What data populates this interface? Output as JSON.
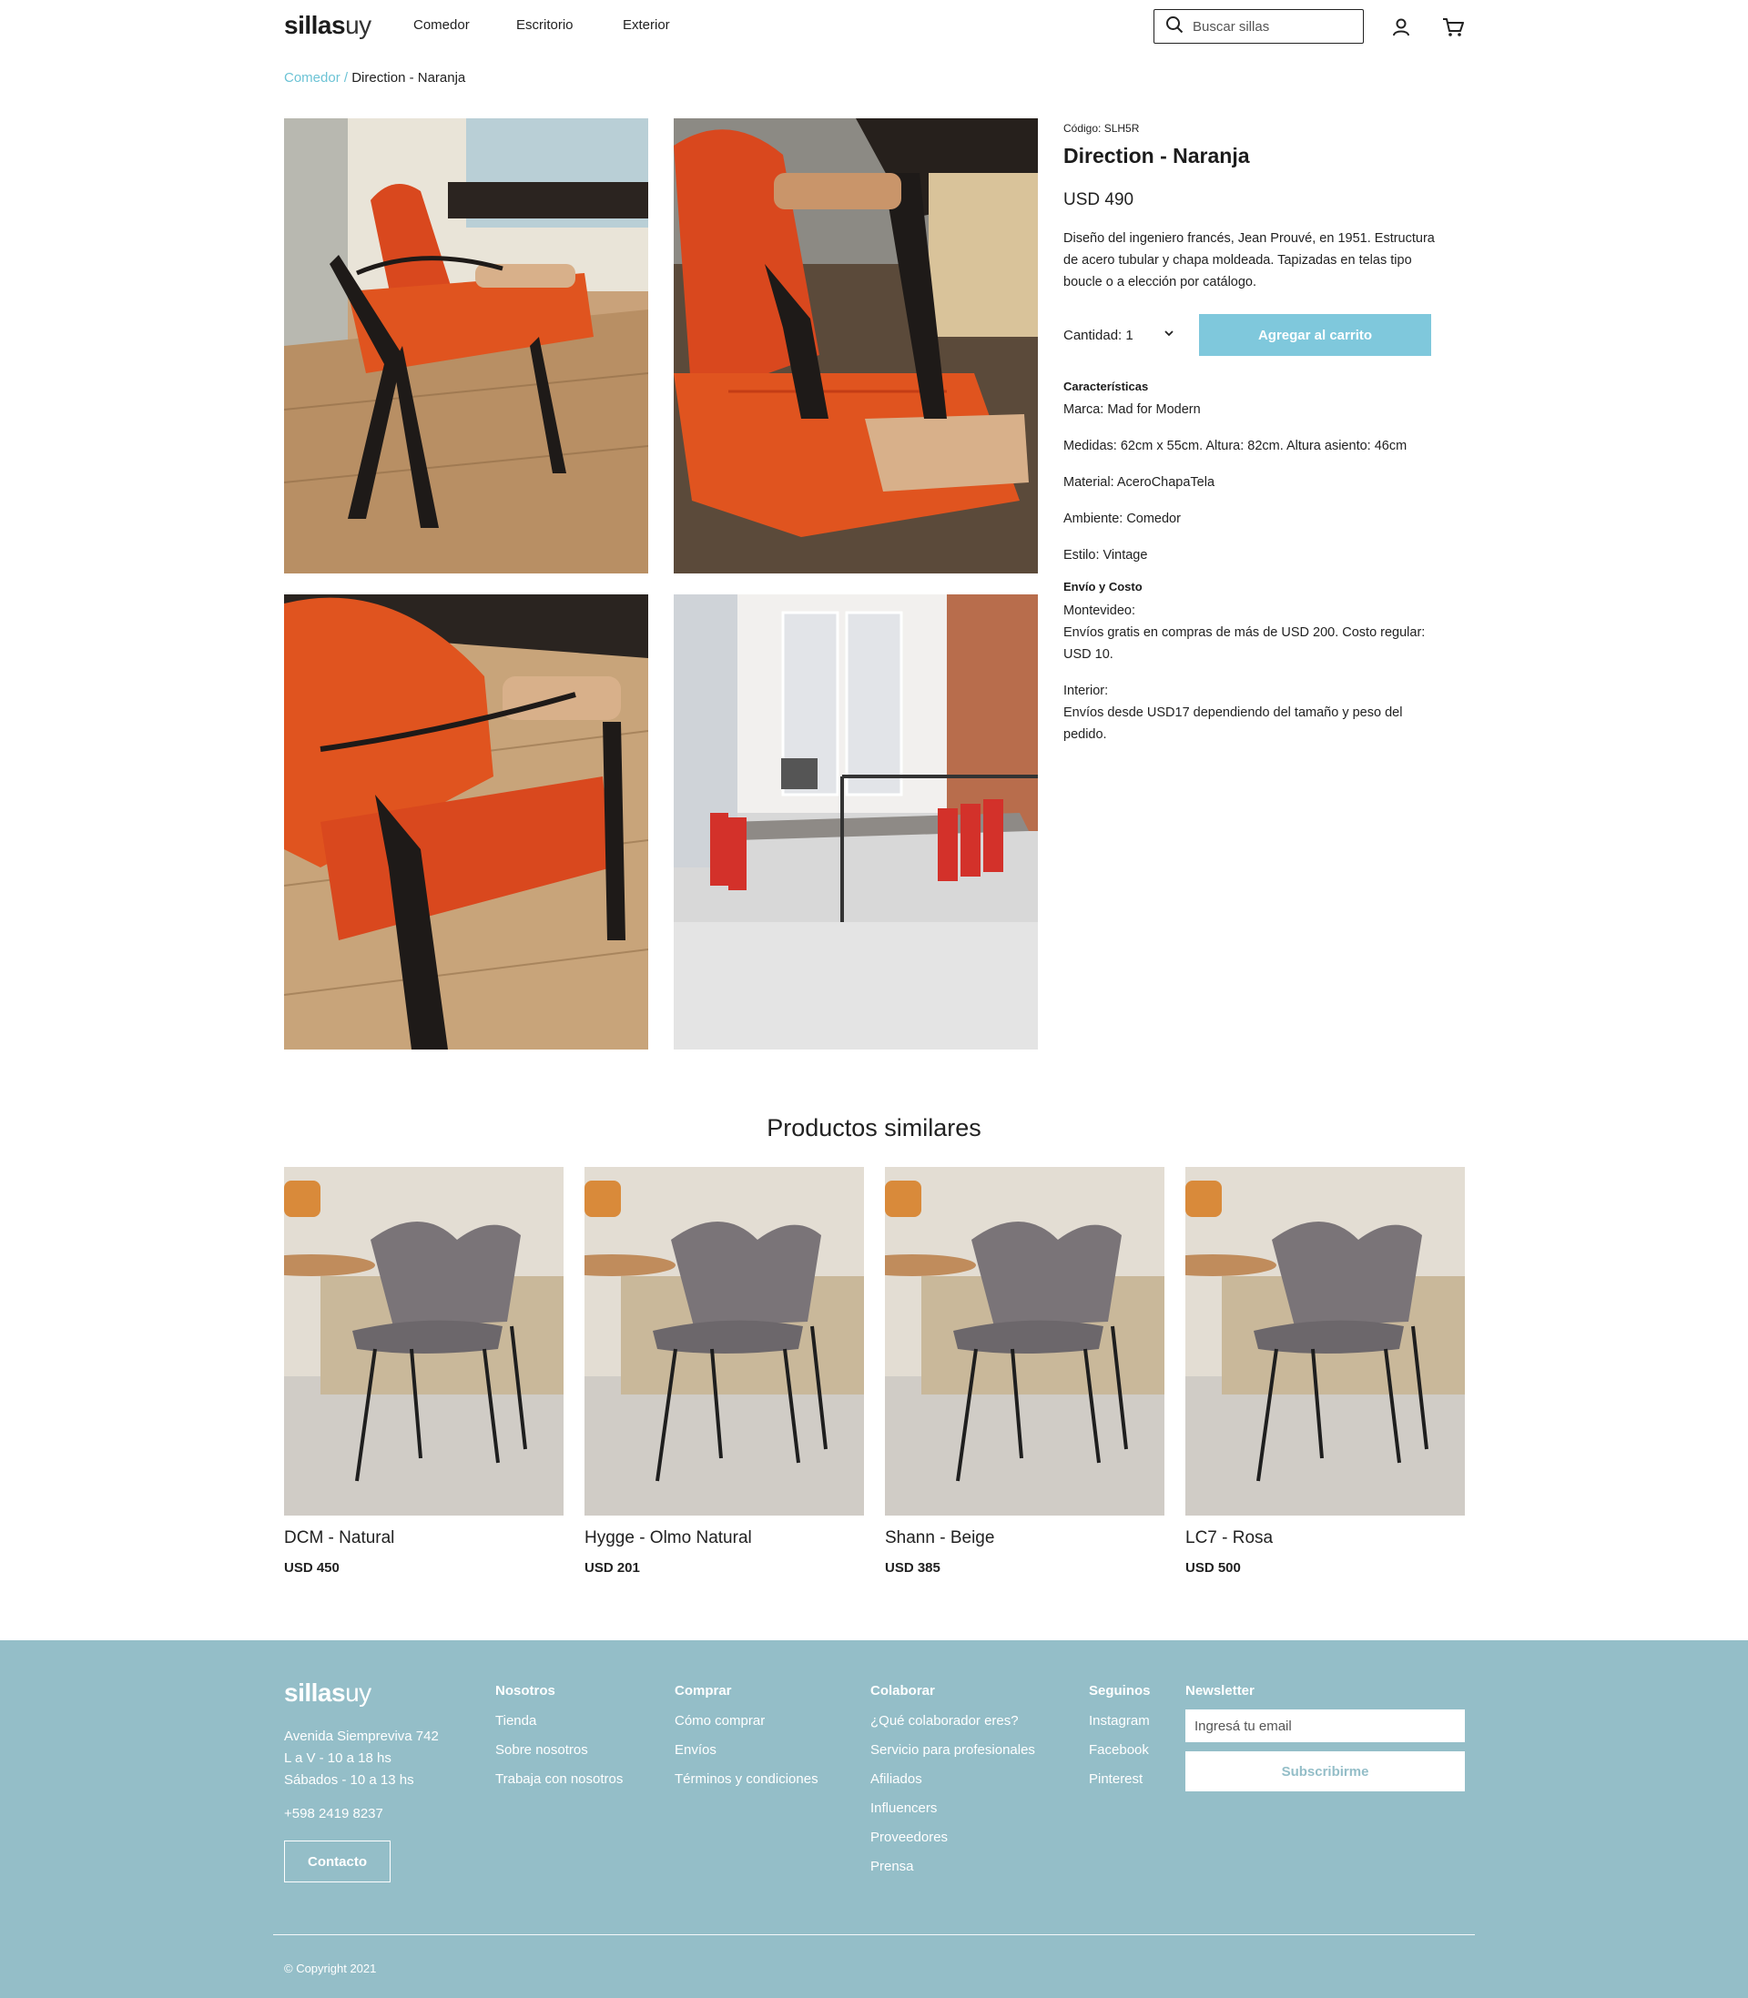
{
  "header": {
    "logo_bold": "sillas",
    "logo_light": "uy",
    "nav": [
      "Comedor",
      "Escritorio",
      "Exterior"
    ],
    "search_placeholder": "Buscar sillas"
  },
  "breadcrumb": {
    "link": "Comedor",
    "separator": " / ",
    "current": "Direction - Naranja"
  },
  "product": {
    "code": "Código: SLH5R",
    "title": "Direction - Naranja",
    "price": "USD 490",
    "description": "Diseño del ingeniero francés, Jean Prouvé, en 1951. Estructura de acero tubular y chapa moldeada. Tapizadas en telas tipo boucle o a elección por catálogo.",
    "quantity_label": "Cantidad: 1",
    "add_to_cart": "Agregar al carrito",
    "features_heading": "Características",
    "features": [
      "Marca: Mad for Modern",
      "Medidas: 62cm x 55cm. Altura: 82cm. Altura asiento: 46cm",
      "Material: AceroChapaTela",
      "Ambiente: Comedor",
      "Estilo: Vintage"
    ],
    "shipping_heading": "Envío y Costo",
    "shipping_mvd_title": "Montevideo:",
    "shipping_mvd_text": "Envíos gratis en compras de más de USD 200. Costo regular: USD 10.",
    "shipping_int_title": "Interior:",
    "shipping_int_text": "Envíos desde USD17 dependiendo del tamaño y peso del pedido."
  },
  "similar": {
    "title": "Productos similares",
    "items": [
      {
        "name": "DCM - Natural",
        "price": "USD 450"
      },
      {
        "name": "Hygge - Olmo Natural",
        "price": "USD 201"
      },
      {
        "name": "Shann - Beige",
        "price": "USD 385"
      },
      {
        "name": "LC7 - Rosa",
        "price": "USD 500"
      }
    ]
  },
  "footer": {
    "logo_bold": "sillas",
    "logo_light": "uy",
    "address": [
      "Avenida Siempreviva 742",
      "L a V - 10 a 18 hs",
      "Sábados - 10 a 13 hs"
    ],
    "phone": "+598 2419 8237",
    "contact_button": "Contacto",
    "columns": [
      {
        "heading": "Nosotros",
        "links": [
          "Tienda",
          "Sobre nosotros",
          "Trabaja con nosotros"
        ]
      },
      {
        "heading": "Comprar",
        "links": [
          "Cómo comprar",
          "Envíos",
          "Términos y condiciones"
        ]
      },
      {
        "heading": "Colaborar",
        "links": [
          "¿Qué colaborador eres?",
          "Servicio para profesionales",
          "Afiliados",
          "Influencers",
          "Proveedores",
          "Prensa"
        ]
      },
      {
        "heading": "Seguinos",
        "links": [
          "Instagram",
          "Facebook",
          "Pinterest"
        ]
      }
    ],
    "newsletter_heading": "Newsletter",
    "newsletter_placeholder": "Ingresá tu email",
    "newsletter_button": "Subscribirme",
    "copyright": "© Copyright 2021"
  },
  "colors": {
    "accent": "#7fc8dc",
    "breadcrumb_link": "#6cc3d5",
    "footer_bg": "#94bec8",
    "chair_orange": "#d9481e"
  }
}
